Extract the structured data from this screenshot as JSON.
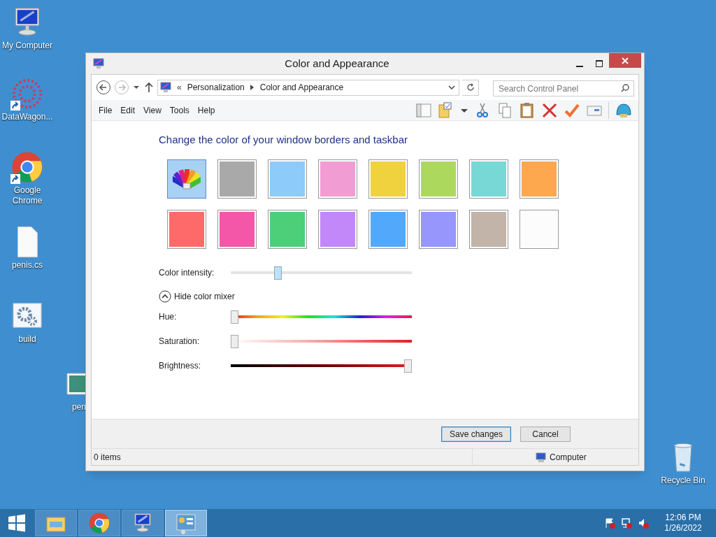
{
  "desktop_icons": [
    {
      "kind": "computer",
      "label": "My Computer",
      "shortcut": false
    },
    {
      "kind": "app",
      "label": "DataWagon...",
      "shortcut": true
    },
    {
      "kind": "chrome",
      "label": "Google Chrome",
      "shortcut": true
    },
    {
      "kind": "file",
      "label": "penis.cs",
      "shortcut": false
    },
    {
      "kind": "settings",
      "label": "build",
      "shortcut": false
    },
    {
      "kind": "image",
      "label": "pen",
      "shortcut": false
    },
    {
      "kind": "recycle",
      "label": "Recycle Bin",
      "shortcut": false
    }
  ],
  "window": {
    "title": "Color and Appearance",
    "address": {
      "prefix": "«",
      "crumbs": [
        "Personalization",
        "Color and Appearance"
      ]
    },
    "search": {
      "placeholder": "Search Control Panel"
    },
    "menu": [
      "File",
      "Edit",
      "View",
      "Tools",
      "Help"
    ],
    "heading": "Change the color of your window borders and taskbar",
    "swatches": [
      {
        "kind": "automatic",
        "selected": true
      },
      {
        "kind": "color",
        "color": "#a9a9a9",
        "selected": false
      },
      {
        "kind": "color",
        "color": "#8ccbfa",
        "selected": false
      },
      {
        "kind": "color",
        "color": "#f29cd4",
        "selected": false
      },
      {
        "kind": "color",
        "color": "#efd23e",
        "selected": false
      },
      {
        "kind": "color",
        "color": "#acd95d",
        "selected": false
      },
      {
        "kind": "color",
        "color": "#77d8d6",
        "selected": false
      },
      {
        "kind": "color",
        "color": "#fda74e",
        "selected": false
      },
      {
        "kind": "color",
        "color": "#fe6a6a",
        "selected": false
      },
      {
        "kind": "color",
        "color": "#f456a8",
        "selected": false
      },
      {
        "kind": "color",
        "color": "#4ccf78",
        "selected": false
      },
      {
        "kind": "color",
        "color": "#c287f8",
        "selected": false
      },
      {
        "kind": "color",
        "color": "#52a9fc",
        "selected": false
      },
      {
        "kind": "color",
        "color": "#9696fc",
        "selected": false
      },
      {
        "kind": "color",
        "color": "#c2b4a8",
        "selected": false
      },
      {
        "kind": "color",
        "color": "#fcfcfc",
        "selected": false
      }
    ],
    "intensity": {
      "label": "Color intensity:",
      "level": 0.25
    },
    "mixer": {
      "label": "Hide color mixer",
      "expanded": true
    },
    "mixer_sliders": [
      {
        "kind": "hue",
        "label": "Hue:",
        "level": 0
      },
      {
        "kind": "saturation",
        "label": "Saturation:",
        "level": 0
      },
      {
        "kind": "brightness",
        "label": "Brightness:",
        "level": 1
      }
    ],
    "buttons": [
      "Save changes",
      "Cancel"
    ],
    "status_bar": {
      "items": "0 items",
      "location": "Computer"
    }
  },
  "taskbar": {
    "items": [
      {
        "kind": "explorer",
        "selected": false
      },
      {
        "kind": "chrome",
        "selected": false
      },
      {
        "kind": "computer",
        "selected": false
      },
      {
        "kind": "control",
        "selected": true
      }
    ],
    "tray": [
      {
        "kind": "flag"
      },
      {
        "kind": "network"
      },
      {
        "kind": "volume"
      }
    ],
    "time": "12:06 PM",
    "date": "1/26/2022"
  }
}
